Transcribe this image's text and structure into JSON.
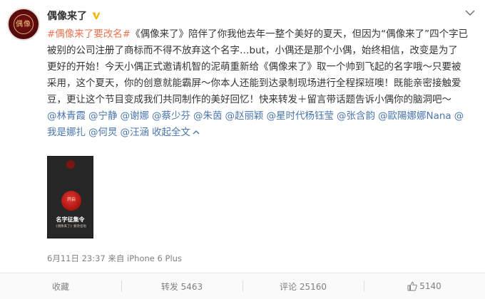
{
  "post": {
    "user_name": "偶像来了",
    "content_lines": [
      [
        "#偶像来了要改名#",
        "《偶像来了》陪伴了你我他去年一整个美好的夏天，但因为“偶像来了”四个字已"
      ],
      [
        "被别的公司注册了商标而不得不放弃这个名字…but，小偶还是那个小偶，始终相信，改变是为了"
      ],
      [
        "更好的开始！今天小偶正式邀请机智的泥萌重新给《偶像来了》取一个帅到飞起的名字哦～只要被"
      ],
      [
        "采用，这个夏天，你的创意就能霸屏～你本人还能到达录制现场进行全程探班噢！既能亲密接触爱"
      ],
      [
        "豆，更让这个节目变成我们共同制作的美好回忆！快来转发＋留言带话题告诉小偶你的脑洞吧～"
      ]
    ],
    "mentions_line1": [
      "@林青霞",
      "@宁静",
      "@谢娜",
      "@蔡少芬",
      "@朱茵",
      "@赵丽颖",
      "@星时代杨钰莹",
      "@张含韵",
      "@歐陽娜娜Nana",
      "@"
    ],
    "mentions_line2": [
      "我是娜扎",
      "@何炅",
      "@汪涵"
    ],
    "collapse_label": "收起全文",
    "poster": {
      "seal_text": "开启",
      "title": "名字征集令",
      "subtitle": "《偶像来了》要改名啦"
    },
    "meta": "6月11日 23:37 来自 iPhone 6 Plus"
  },
  "actions": {
    "favorite": "收藏",
    "repost": "转发 5463",
    "comment": "评论 25160",
    "like": "5140"
  },
  "colors": {
    "topic": "#eb7350",
    "link": "#4a76ad",
    "verified": "#f7b500"
  }
}
